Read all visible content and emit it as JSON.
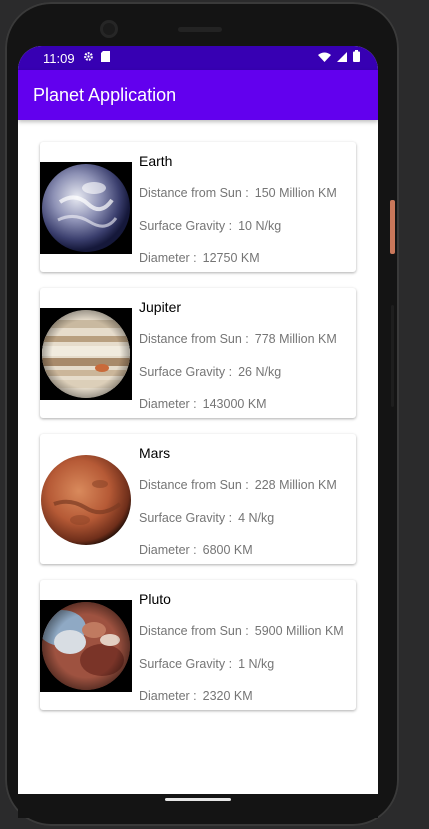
{
  "status_bar": {
    "time": "11:09",
    "icons": [
      "settings-icon",
      "sd-card-icon",
      "wifi-icon",
      "signal-icon",
      "battery-icon"
    ]
  },
  "app_bar": {
    "title": "Planet Application",
    "color": "#6200ee",
    "status_color": "#3700b3"
  },
  "planets": [
    {
      "name": "Earth",
      "distance_label": "Distance from Sun :",
      "distance": "150 Million KM",
      "gravity_label": "Surface Gravity :",
      "gravity": "10 N/kg",
      "diameter_label": "Diameter :",
      "diameter": "12750 KM",
      "image": "earth-image"
    },
    {
      "name": "Jupiter",
      "distance_label": "Distance from Sun :",
      "distance": "778 Million KM",
      "gravity_label": "Surface Gravity :",
      "gravity": "26 N/kg",
      "diameter_label": "Diameter :",
      "diameter": "143000 KM",
      "image": "jupiter-image"
    },
    {
      "name": "Mars",
      "distance_label": "Distance from Sun :",
      "distance": "228 Million KM",
      "gravity_label": "Surface Gravity :",
      "gravity": "4 N/kg",
      "diameter_label": "Diameter :",
      "diameter": "6800 KM",
      "image": "mars-image"
    },
    {
      "name": "Pluto",
      "distance_label": "Distance from Sun :",
      "distance": "5900 Million KM",
      "gravity_label": "Surface Gravity :",
      "gravity": "1 N/kg",
      "diameter_label": "Diameter :",
      "diameter": "2320 KM",
      "image": "pluto-image"
    }
  ]
}
